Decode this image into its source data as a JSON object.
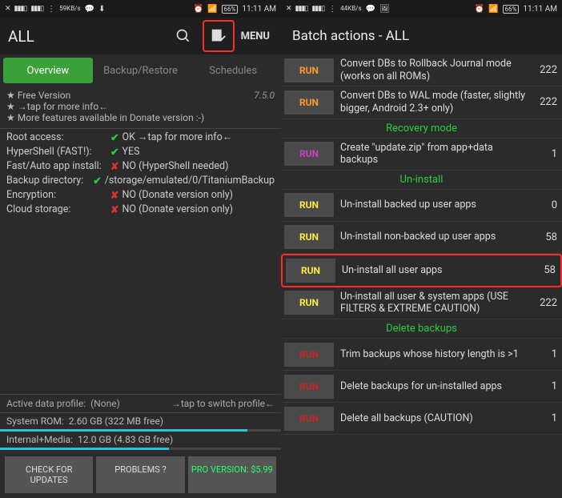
{
  "left": {
    "status": {
      "kbs": "59",
      "kbs_unit": "KB/s",
      "battery": "66%",
      "time": "11:11 AM"
    },
    "appbar": {
      "title": "ALL",
      "menu": "MENU"
    },
    "tabs": [
      {
        "label": "Overview",
        "active": true
      },
      {
        "label": "Backup/Restore",
        "active": false
      },
      {
        "label": "Schedules",
        "active": false
      }
    ],
    "info": {
      "line1": "★ Free Version",
      "line2": "★  →tap for more info←",
      "line3": "★ More features available in Donate version :-)",
      "version": "7.5.0"
    },
    "kv": [
      {
        "k": "Root access:",
        "ok": true,
        "v": "OK →tap for more info←"
      },
      {
        "k": "HyperShell (FAST!):",
        "ok": true,
        "v": "YES"
      },
      {
        "k": "Fast/Auto app install:",
        "ok": false,
        "v": "NO (HyperShell needed)"
      },
      {
        "k": "Backup directory:",
        "ok": true,
        "v": "/storage/emulated/0/TitaniumBackup"
      },
      {
        "k": "Encryption:",
        "ok": false,
        "v": "NO (Donate version only)"
      },
      {
        "k": "Cloud storage:",
        "ok": false,
        "v": "NO (Donate version only)"
      }
    ],
    "profile": {
      "label": "Active data profile:",
      "value": "(None)",
      "hint": "→tap to switch profile←"
    },
    "storage": [
      {
        "label": "System ROM:",
        "value": "2.60 GB (322 MB free)",
        "pct": 88
      },
      {
        "label": "Internal+Media:",
        "value": "12.0 GB (4.83 GB free)",
        "pct": 60
      }
    ],
    "buttons": {
      "check": "CHECK FOR UPDATES",
      "problems": "PROBLEMS ?",
      "pro": "PRO VERSION: $5.99"
    }
  },
  "right": {
    "status": {
      "kbs": "44",
      "kbs_unit": "KB/s",
      "battery": "66%",
      "time": "11:11 AM"
    },
    "title": "Batch actions - ALL",
    "rows": [
      {
        "type": "row",
        "run": "orange",
        "label": "Convert DBs to Rollback Journal mode (works on all ROMs)",
        "count": "222"
      },
      {
        "type": "row",
        "run": "orange",
        "label": "Convert DBs to WAL mode (faster, slightly bigger, Android 2.3+ only)",
        "count": "222"
      },
      {
        "type": "section",
        "label": "Recovery mode"
      },
      {
        "type": "row",
        "run": "magenta",
        "label": "Create \"update.zip\" from app+data backups",
        "count": "1"
      },
      {
        "type": "section",
        "label": "Un-install"
      },
      {
        "type": "row",
        "run": "yellow",
        "label": "Un-install backed up user apps",
        "count": "0"
      },
      {
        "type": "row",
        "run": "yellow",
        "label": "Un-install non-backed up user apps",
        "count": "58"
      },
      {
        "type": "row",
        "run": "yellow",
        "label": "Un-install all user apps",
        "count": "58",
        "highlight": true
      },
      {
        "type": "row",
        "run": "yellow",
        "label": "Un-install all user & system apps (USE FILTERS & EXTREME CAUTION)",
        "count": "222"
      },
      {
        "type": "section",
        "label": "Delete backups"
      },
      {
        "type": "row",
        "run": "red",
        "label": "Trim backups whose history length is >1",
        "count": "1"
      },
      {
        "type": "row",
        "run": "red",
        "label": "Delete backups for un-installed apps",
        "count": "1"
      },
      {
        "type": "row",
        "run": "red",
        "label": "Delete all backups (CAUTION)",
        "count": "1"
      }
    ],
    "runlabel": "RUN"
  }
}
